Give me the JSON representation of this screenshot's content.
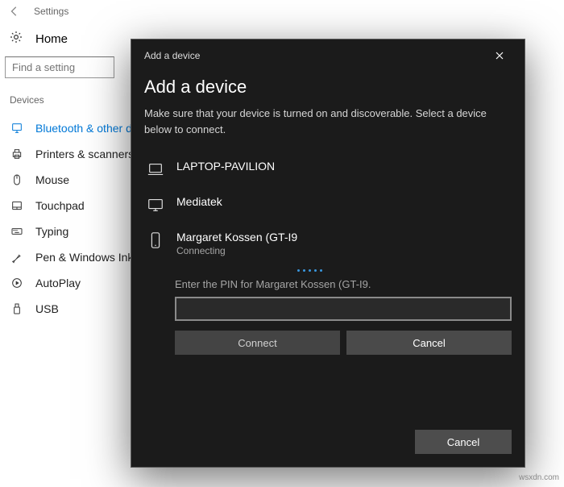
{
  "header": {
    "page_label": "Settings",
    "home_label": "Home",
    "search_placeholder": "Find a setting"
  },
  "sidebar": {
    "heading": "Devices",
    "items": [
      {
        "label": "Bluetooth & other dev",
        "active": true
      },
      {
        "label": "Printers & scanners"
      },
      {
        "label": "Mouse"
      },
      {
        "label": "Touchpad"
      },
      {
        "label": "Typing"
      },
      {
        "label": "Pen & Windows Ink"
      },
      {
        "label": "AutoPlay"
      },
      {
        "label": "USB"
      }
    ]
  },
  "dialog": {
    "title_small": "Add a device",
    "title": "Add a device",
    "subtitle": "Make sure that your device is turned on and discoverable. Select a device below to connect.",
    "devices": [
      {
        "name": "LAPTOP-PAVILION"
      },
      {
        "name": "Mediatek"
      },
      {
        "name": "Margaret Kossen (GT-I9",
        "status": "Connecting"
      }
    ],
    "enter_pin": "Enter the PIN for Margaret Kossen (GT-I9.",
    "connect_label": "Connect",
    "cancel_label": "Cancel",
    "footer_cancel": "Cancel"
  },
  "watermark": "wsxdn.com"
}
